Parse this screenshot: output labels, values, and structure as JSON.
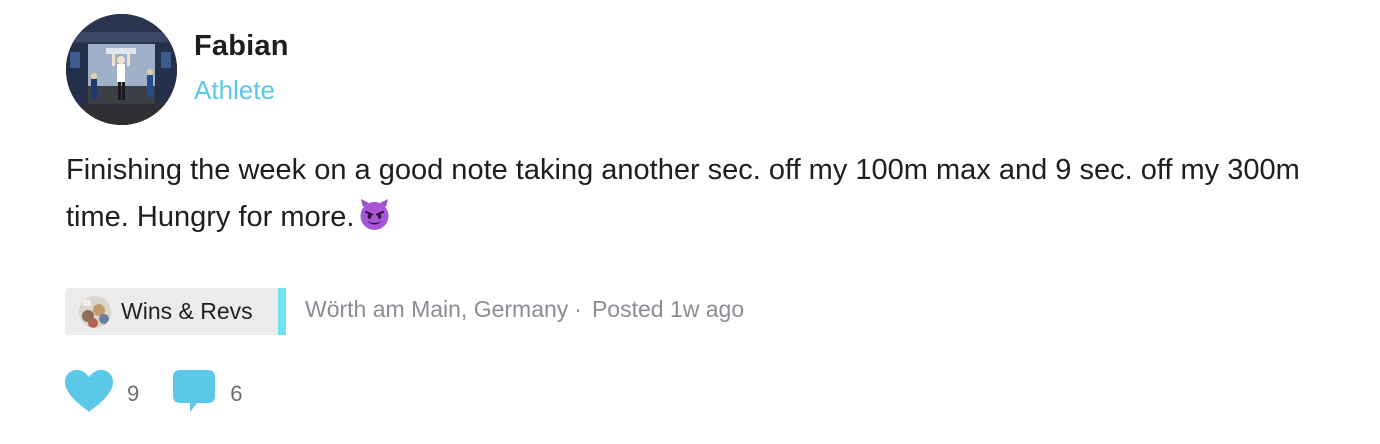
{
  "author": {
    "name": "Fabian",
    "role": "Athlete"
  },
  "post": {
    "text": "Finishing the week on a good note taking another sec. off my 100m max and 9 sec. off my 300m time. Hungry for more.",
    "emoji": "smiling-face-with-horns"
  },
  "meta": {
    "group": "Wins & Revs",
    "location": "Wörth am Main, Germany",
    "separator": "·",
    "posted": "Posted 1w ago"
  },
  "actions": {
    "likes": "9",
    "comments": "6"
  },
  "colors": {
    "accent": "#5bc8e8",
    "tag_background": "#ebebed",
    "tag_border": "#6fe4ef",
    "meta_text": "#8a8e94"
  }
}
